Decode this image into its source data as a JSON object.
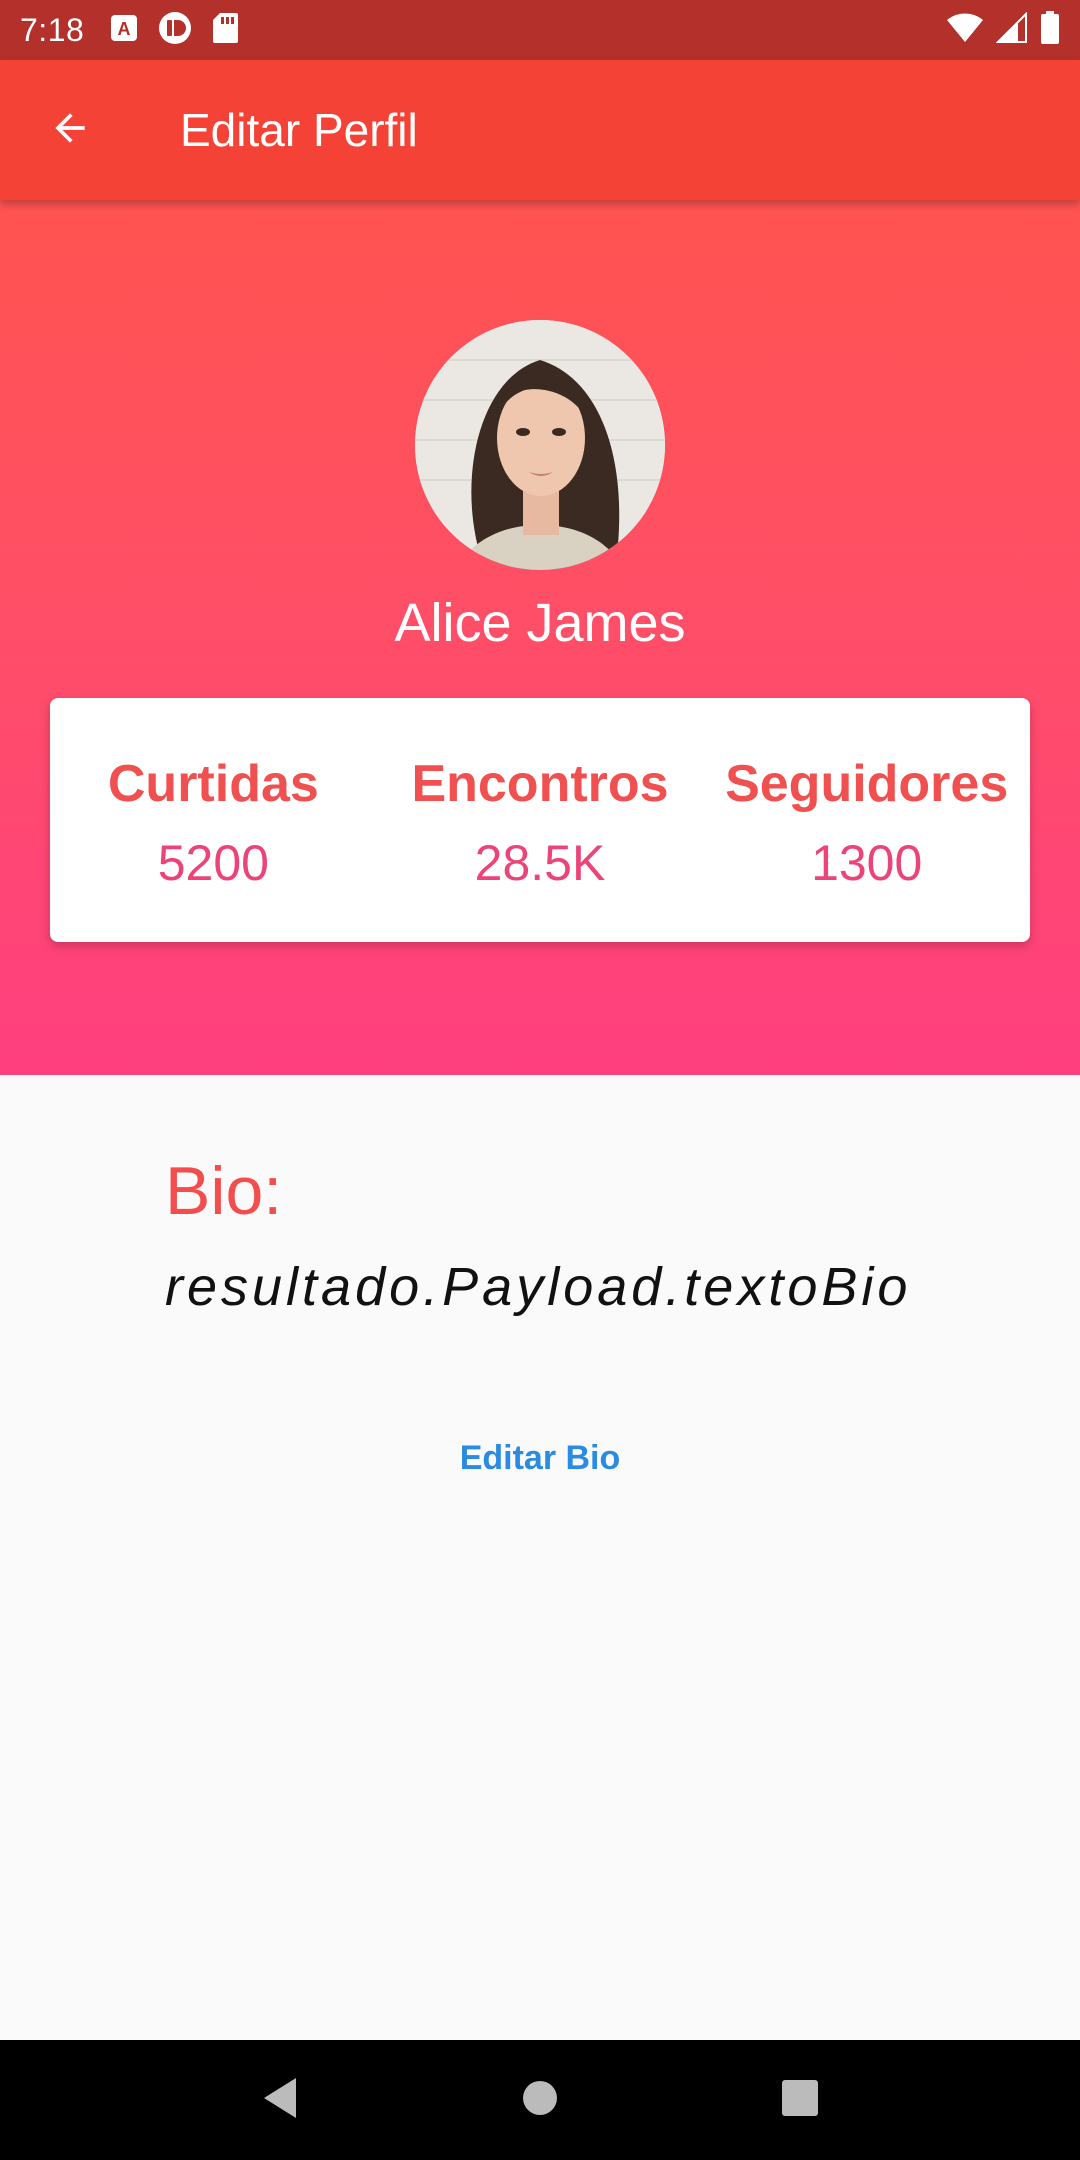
{
  "status_bar": {
    "time": "7:18",
    "left_icons": [
      "a-icon",
      "pushbullet-icon",
      "sd-card-icon"
    ],
    "right_icons": [
      "wifi-icon",
      "signal-icon",
      "battery-icon"
    ]
  },
  "app_bar": {
    "title": "Editar Perfil",
    "back_icon": "arrow-back-icon"
  },
  "profile": {
    "name": "Alice James"
  },
  "stats": [
    {
      "label": "Curtidas",
      "value": "5200"
    },
    {
      "label": "Encontros",
      "value": "28.5K"
    },
    {
      "label": "Seguidores",
      "value": "1300"
    }
  ],
  "bio": {
    "title": "Bio:",
    "text": "resultado.Payload.textoBio",
    "edit_label": "Editar Bio"
  },
  "nav_bar": {
    "buttons": [
      "back-triangle-icon",
      "home-circle-icon",
      "recents-square-icon"
    ]
  },
  "colors": {
    "status_bar": "#b3312a",
    "app_bar": "#f44336",
    "gradient_top": "#ff5350",
    "gradient_bottom": "#ff3f7f",
    "stat_label": "#f05050",
    "stat_value": "#ec4378",
    "bio_title": "#f44d4d",
    "link": "#2b8be0"
  }
}
